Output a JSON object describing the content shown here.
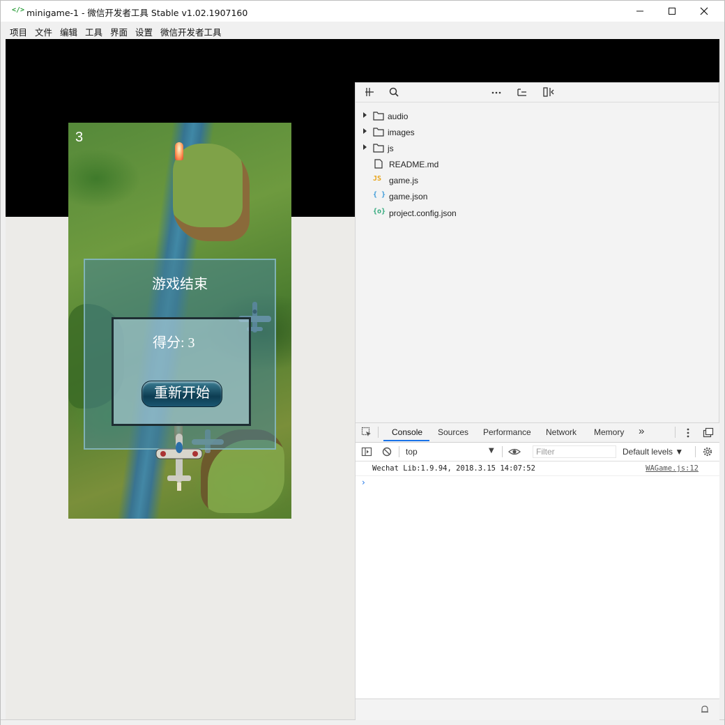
{
  "window": {
    "app_icon": "</>",
    "title": "minigame-1 - 微信开发者工具 Stable v1.02.1907160",
    "minimize": "—",
    "maximize": "☐",
    "close": "✕"
  },
  "menu": [
    "项目",
    "文件",
    "编辑",
    "工具",
    "界面",
    "设置",
    "微信开发者工具"
  ],
  "game": {
    "score_counter": "3",
    "panel_title": "游戏结束",
    "score_text": "得分: 3",
    "restart_label": "重新开始"
  },
  "file_tree": {
    "folders": [
      "audio",
      "images",
      "js"
    ],
    "files": [
      {
        "name": "README.md",
        "icon": "document-icon"
      },
      {
        "name": "game.js",
        "icon": "js-file-icon",
        "badge": "JS"
      },
      {
        "name": "game.json",
        "icon": "json-file-icon",
        "badge": "{ }"
      },
      {
        "name": "project.config.json",
        "icon": "config-file-icon",
        "badge": "{o}"
      }
    ]
  },
  "devtools": {
    "tabs": [
      "Console",
      "Sources",
      "Performance",
      "Network",
      "Memory"
    ],
    "active_tab": "Console",
    "more_tabs": "»",
    "context": "top",
    "filter_placeholder": "Filter",
    "levels": "Default levels ▼",
    "log": {
      "message": "Wechat Lib:1.9.94, 2018.3.15 14:07:52",
      "source": "WAGame.js:12"
    },
    "prompt": "›"
  },
  "colors": {
    "accent": "#1a73e8",
    "titlebar": "#ffffff",
    "simulator_top": "#000000",
    "simulator_bottom": "#ecebe8"
  }
}
